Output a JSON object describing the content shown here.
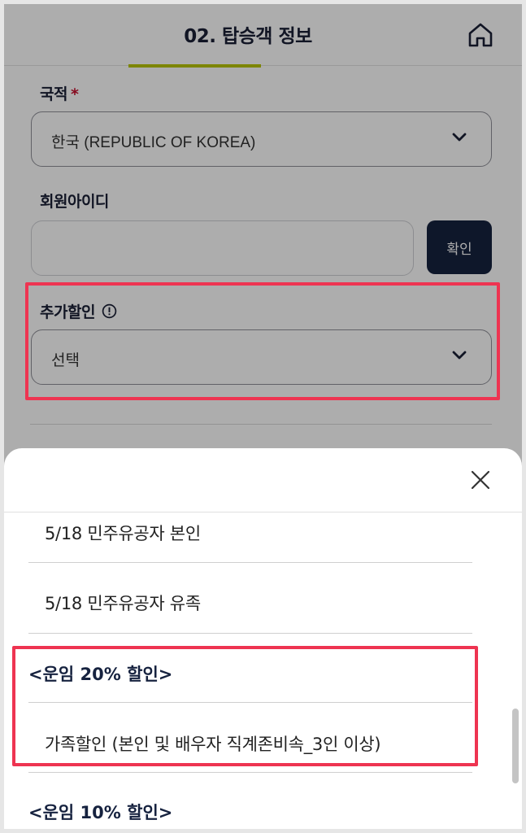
{
  "header": {
    "title": "02. 탑승객 정보"
  },
  "form": {
    "nationality_label": "국적",
    "required_mark": "*",
    "nationality_value": "한국 (REPUBLIC OF KOREA)",
    "member_id_label": "회원아이디",
    "member_id_value": "",
    "confirm_label": "확인",
    "discount_label": "추가할인",
    "discount_value": "선택"
  },
  "icons": {
    "home": "home-icon",
    "chevron": "chevron-down-icon",
    "info": "info-icon",
    "close": "close-icon"
  },
  "sheet": {
    "options": [
      {
        "label": "5/18 민주유공자 본인",
        "group": false
      },
      {
        "label": "5/18 민주유공자 유족",
        "group": false
      },
      {
        "label": "<운임 20% 할인>",
        "group": true
      },
      {
        "label": "가족할인 (본인 및 배우자 직계존비속_3인 이상)",
        "group": false
      },
      {
        "label": "<운임 10% 할인>",
        "group": true
      }
    ]
  },
  "colors": {
    "accent_bar": "#b8c400",
    "navy": "#16223f",
    "highlight": "#ee3451",
    "required": "#c8102e"
  }
}
